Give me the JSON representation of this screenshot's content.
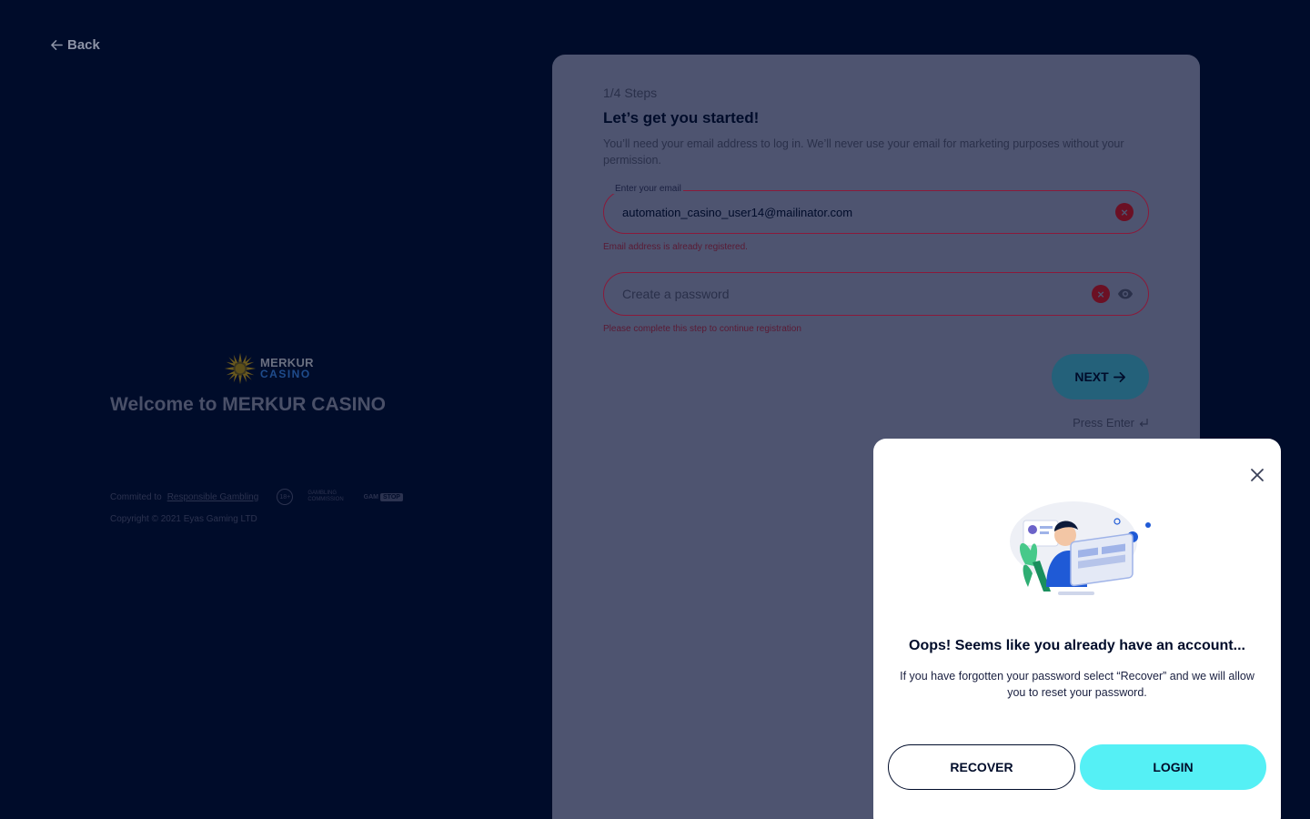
{
  "nav": {
    "back_label": "Back"
  },
  "brand": {
    "logo_line1": "MERKUR",
    "logo_line2": "CASINO",
    "welcome": "Welcome to MERKUR CASINO"
  },
  "footer": {
    "committed_prefix": "Commited to",
    "responsible_link": "Responsible Gambling",
    "age_badge": "18+",
    "gc_line1": "GAMBLING",
    "gc_line2": "COMMISSION",
    "gamstop_a": "GAM",
    "gamstop_b": "STOP",
    "copyright": "Copyright © 2021 Eyas Gaming LTD"
  },
  "form": {
    "steps": "1/4 Steps",
    "heading": "Let’s get you started!",
    "intro": "You’ll need your email address to log in. We’ll never use your email for marketing purposes without your permission.",
    "email_label": "Enter your email",
    "email_value": "automation_casino_user14@mailinator.com",
    "email_error": "Email address is already registered.",
    "password_placeholder": "Create a password",
    "password_error": "Please complete this step to continue registration",
    "next_label": "NEXT",
    "press_enter": "Press Enter"
  },
  "modal": {
    "title": "Oops! Seems like you already have an account...",
    "body": "If you have forgotten your password select “Recover” and we will allow you to reset your password.",
    "recover_label": "RECOVER",
    "login_label": "LOGIN"
  },
  "colors": {
    "background": "#000c2a",
    "card": "#4e5470",
    "error": "#8a1a3a",
    "login_accent": "#55f0f5"
  }
}
